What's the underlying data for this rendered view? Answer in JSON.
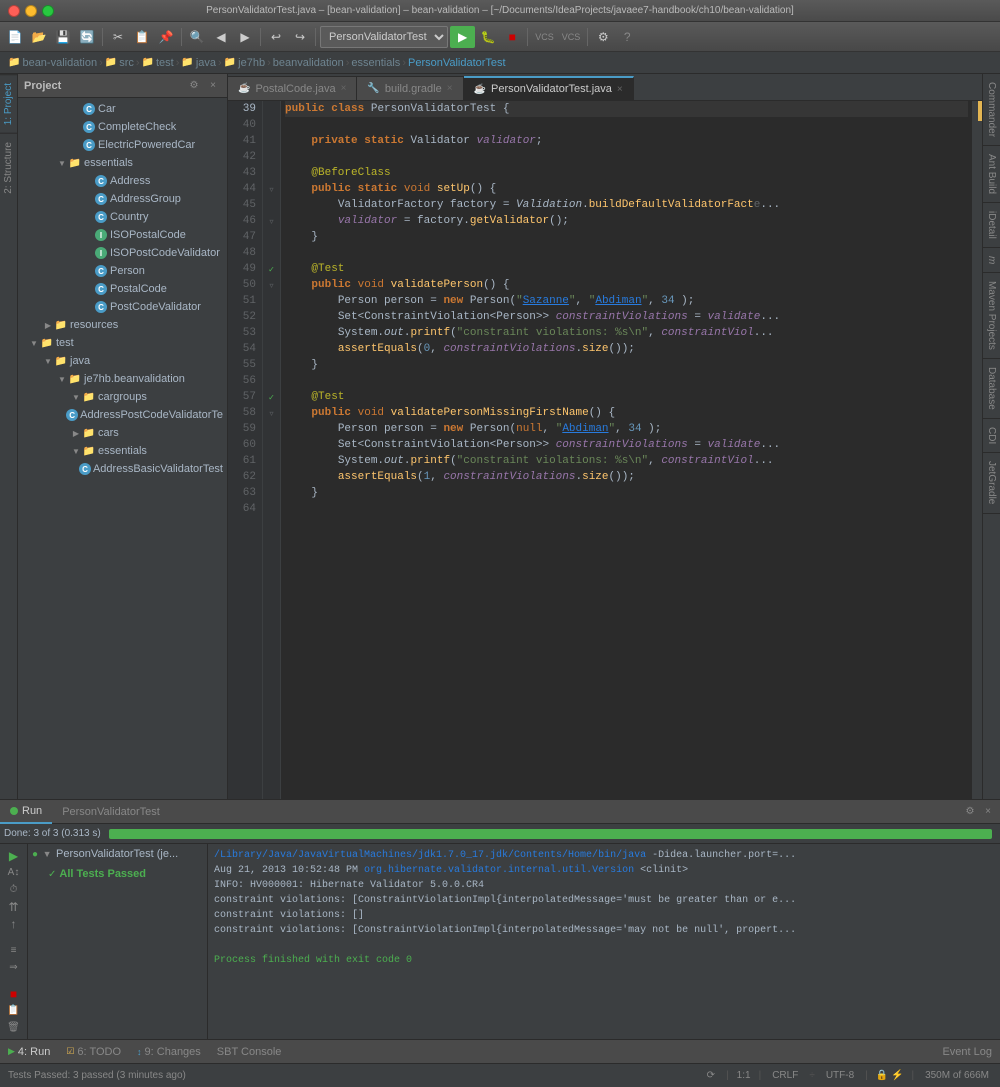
{
  "titlebar": {
    "text": "PersonValidatorTest.java – [bean-validation] – bean-validation – [~/Documents/IdeaProjects/javaee7-handbook/ch10/bean-validation]"
  },
  "breadcrumb": {
    "items": [
      "bean-validation",
      "src",
      "test",
      "java",
      "je7hb",
      "beanvalidation",
      "essentials",
      "PersonValidatorTest"
    ]
  },
  "project_panel": {
    "title": "Project",
    "tree_items": [
      {
        "id": 1,
        "indent": 0,
        "type": "class",
        "label": "Car",
        "depth": 3
      },
      {
        "id": 2,
        "indent": 0,
        "type": "class",
        "label": "CompleteCheck",
        "depth": 3
      },
      {
        "id": 3,
        "indent": 0,
        "type": "class",
        "label": "ElectricPoweredCar",
        "depth": 3
      },
      {
        "id": 4,
        "indent": 0,
        "type": "folder",
        "label": "essentials",
        "depth": 2,
        "expanded": true
      },
      {
        "id": 5,
        "indent": 0,
        "type": "class",
        "label": "Address",
        "depth": 3
      },
      {
        "id": 6,
        "indent": 0,
        "type": "class",
        "label": "AddressGroup",
        "depth": 3
      },
      {
        "id": 7,
        "indent": 0,
        "type": "class",
        "label": "Country",
        "depth": 3
      },
      {
        "id": 8,
        "indent": 0,
        "type": "interface",
        "label": "ISOPostalCode",
        "depth": 3
      },
      {
        "id": 9,
        "indent": 0,
        "type": "interface",
        "label": "ISOPostCodeValidator",
        "depth": 3
      },
      {
        "id": 10,
        "indent": 0,
        "type": "class",
        "label": "Person",
        "depth": 3
      },
      {
        "id": 11,
        "indent": 0,
        "type": "class",
        "label": "PostalCode",
        "depth": 3
      },
      {
        "id": 12,
        "indent": 0,
        "type": "class",
        "label": "PostCodeValidator",
        "depth": 3
      },
      {
        "id": 13,
        "indent": 0,
        "type": "folder",
        "label": "resources",
        "depth": 1,
        "expanded": false
      },
      {
        "id": 14,
        "indent": 0,
        "type": "folder",
        "label": "test",
        "depth": 0,
        "expanded": true
      },
      {
        "id": 15,
        "indent": 0,
        "type": "folder",
        "label": "java",
        "depth": 1,
        "expanded": true
      },
      {
        "id": 16,
        "indent": 0,
        "type": "folder",
        "label": "je7hb.beanvalidation",
        "depth": 2,
        "expanded": true
      },
      {
        "id": 17,
        "indent": 0,
        "type": "folder",
        "label": "cargroups",
        "depth": 3,
        "expanded": true
      },
      {
        "id": 18,
        "indent": 0,
        "type": "class",
        "label": "AddressPostCodeValidatorTe",
        "depth": 4
      },
      {
        "id": 19,
        "indent": 0,
        "type": "folder",
        "label": "cars",
        "depth": 3,
        "expanded": false
      },
      {
        "id": 20,
        "indent": 0,
        "type": "folder",
        "label": "essentials",
        "depth": 3,
        "expanded": true
      },
      {
        "id": 21,
        "indent": 0,
        "type": "class",
        "label": "AddressBasicValidatorTest",
        "depth": 4
      }
    ]
  },
  "editor_tabs": [
    {
      "label": "PostalCode.java",
      "active": false,
      "modified": false
    },
    {
      "label": "build.gradle",
      "active": false,
      "modified": false
    },
    {
      "label": "PersonValidatorTest.java",
      "active": true,
      "modified": false
    }
  ],
  "code": {
    "lines": [
      {
        "num": 39,
        "content": "public class PersonValidatorTest {",
        "type": "normal",
        "highlighted": true
      },
      {
        "num": 40,
        "content": "",
        "type": "blank"
      },
      {
        "num": 41,
        "content": "    private static Validator validator;",
        "type": "normal"
      },
      {
        "num": 42,
        "content": "",
        "type": "blank"
      },
      {
        "num": 43,
        "content": "    @BeforeClass",
        "type": "annotation"
      },
      {
        "num": 44,
        "content": "    public static void setUp() {",
        "type": "normal"
      },
      {
        "num": 45,
        "content": "        ValidatorFactory factory = Validation.buildDefaultValidatorFactory();",
        "type": "normal"
      },
      {
        "num": 46,
        "content": "        validator = factory.getValidator();",
        "type": "normal"
      },
      {
        "num": 47,
        "content": "    }",
        "type": "normal"
      },
      {
        "num": 48,
        "content": "",
        "type": "blank"
      },
      {
        "num": 49,
        "content": "    @Test",
        "type": "annotation"
      },
      {
        "num": 50,
        "content": "    public void validatePerson() {",
        "type": "normal"
      },
      {
        "num": 51,
        "content": "        Person person = new Person(\"Sazanne\", \"Abdiman\", 34 );",
        "type": "normal"
      },
      {
        "num": 52,
        "content": "        Set<ConstraintViolation<Person>> constraintViolations = validate...",
        "type": "normal"
      },
      {
        "num": 53,
        "content": "        System.out.printf(\"constraint violations: %s\\n\", constraintViol...",
        "type": "normal"
      },
      {
        "num": 54,
        "content": "        assertEquals(0, constraintViolations.size());",
        "type": "normal"
      },
      {
        "num": 55,
        "content": "    }",
        "type": "normal"
      },
      {
        "num": 56,
        "content": "",
        "type": "blank"
      },
      {
        "num": 57,
        "content": "    @Test",
        "type": "annotation"
      },
      {
        "num": 58,
        "content": "    public void validatePersonMissingFirstName() {",
        "type": "normal"
      },
      {
        "num": 59,
        "content": "        Person person = new Person(null, \"Abdiman\", 34 );",
        "type": "normal"
      },
      {
        "num": 60,
        "content": "        Set<ConstraintViolation<Person>> constraintViolations = validate...",
        "type": "normal"
      },
      {
        "num": 61,
        "content": "        System.out.printf(\"constraint violations: %s\\n\", constraintViol...",
        "type": "normal"
      },
      {
        "num": 62,
        "content": "        assertEquals(1, constraintViolations.size());",
        "type": "normal"
      },
      {
        "num": 63,
        "content": "    }",
        "type": "normal"
      },
      {
        "num": 64,
        "content": "",
        "type": "blank"
      }
    ]
  },
  "right_sidebar": {
    "tabs": [
      "Commander",
      "Ant Build",
      "iDetail",
      "m",
      "Maven Projects",
      "Database",
      "CDI",
      "JetGradle"
    ]
  },
  "run_panel": {
    "title": "PersonValidatorTest",
    "status": "Done: 3 of 3 (0.313 s)",
    "progress": 100,
    "test_suite": {
      "name": "PersonValidatorTest (je...",
      "status": "pass",
      "message": "All Tests Passed"
    },
    "output_lines": [
      "/Library/Java/JavaVirtualMachines/jdk1.7.0_17.jdk/Contents/Home/bin/java -Didea.launcher.port=...",
      "Aug 21, 2013 10:52:48 PM org.hibernate.validator.internal.util.Version <clinit>",
      "INFO: HV000001: Hibernate Validator 5.0.0.CR4",
      "constraint violations: [ConstraintViolationImpl{interpolatedMessage='must be greater than or e...",
      "constraint violations: []",
      "constraint violations: [ConstraintViolationImpl{interpolatedMessage='may not be null', propert...",
      "",
      "Process finished with exit code 0"
    ]
  },
  "status_bar": {
    "left": "Tests Passed: 3 passed (3 minutes ago)",
    "position": "1:1",
    "line_ending": "CRLF",
    "encoding": "UTF-8",
    "memory": "350M of 666M"
  },
  "footer_tabs": [
    {
      "label": "4: Run",
      "icon": "run"
    },
    {
      "label": "6: TODO",
      "icon": "todo"
    },
    {
      "label": "9: Changes",
      "icon": "changes"
    },
    {
      "label": "SBT Console",
      "icon": "sbt"
    }
  ],
  "left_sidebar_tabs": [
    "1: Project",
    "2: Structure"
  ]
}
